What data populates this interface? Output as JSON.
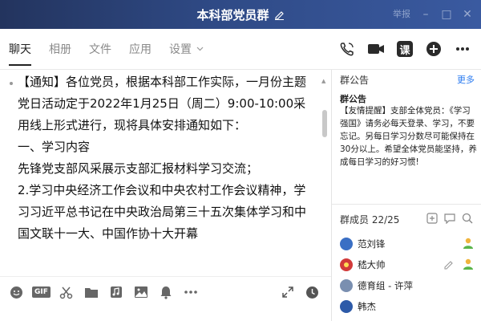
{
  "window": {
    "title": "本科部党员群",
    "report_label": "举报",
    "minimize": "–",
    "maximize": "□",
    "close": "✕"
  },
  "tabs": [
    {
      "label": "聊天",
      "active": true
    },
    {
      "label": "相册"
    },
    {
      "label": "文件"
    },
    {
      "label": "应用"
    },
    {
      "label": "设置"
    }
  ],
  "toolbar": {
    "class_label": "课"
  },
  "message": {
    "text": "【通知】各位党员，根据本科部工作实际，一月份主题党日活动定于2022年1月25日（周二）9:00-10:00采用线上形式进行，现将具体安排通知如下：\n一、学习内容\n先锋党支部风采展示支部汇报材料学习交流；\n2.学习中央经济工作会议和中央农村工作会议精神，学习习近平总书记在中央政治局第三十五次集体学习和中国文联十一大、中国作协十大开幕"
  },
  "input_toolbar": {
    "gif_label": "GIF"
  },
  "announcement": {
    "header": "群公告",
    "more": "更多",
    "title": "群公告",
    "body": "【友情提醒】支部全体党员：《学习强国》请务必每天登录、学习，不要忘记。另每日学习分数尽可能保持在30分以上。希望全体党员能坚持，养成每日学习的好习惯!"
  },
  "members_panel": {
    "header": "群成员 22/25",
    "members": [
      {
        "name": "范刘锋",
        "avatar_color": "#3a6fc4"
      },
      {
        "name": "嵇大帅",
        "avatar_color": "#d23a3a"
      },
      {
        "name": "德育组 - 许萍",
        "avatar_color": "#7a8fb0"
      },
      {
        "name": "韩杰",
        "avatar_color": "#2d5aa8"
      }
    ]
  },
  "colors": {
    "accent": "#2c7cf0",
    "titlebar": "#2b4178"
  }
}
